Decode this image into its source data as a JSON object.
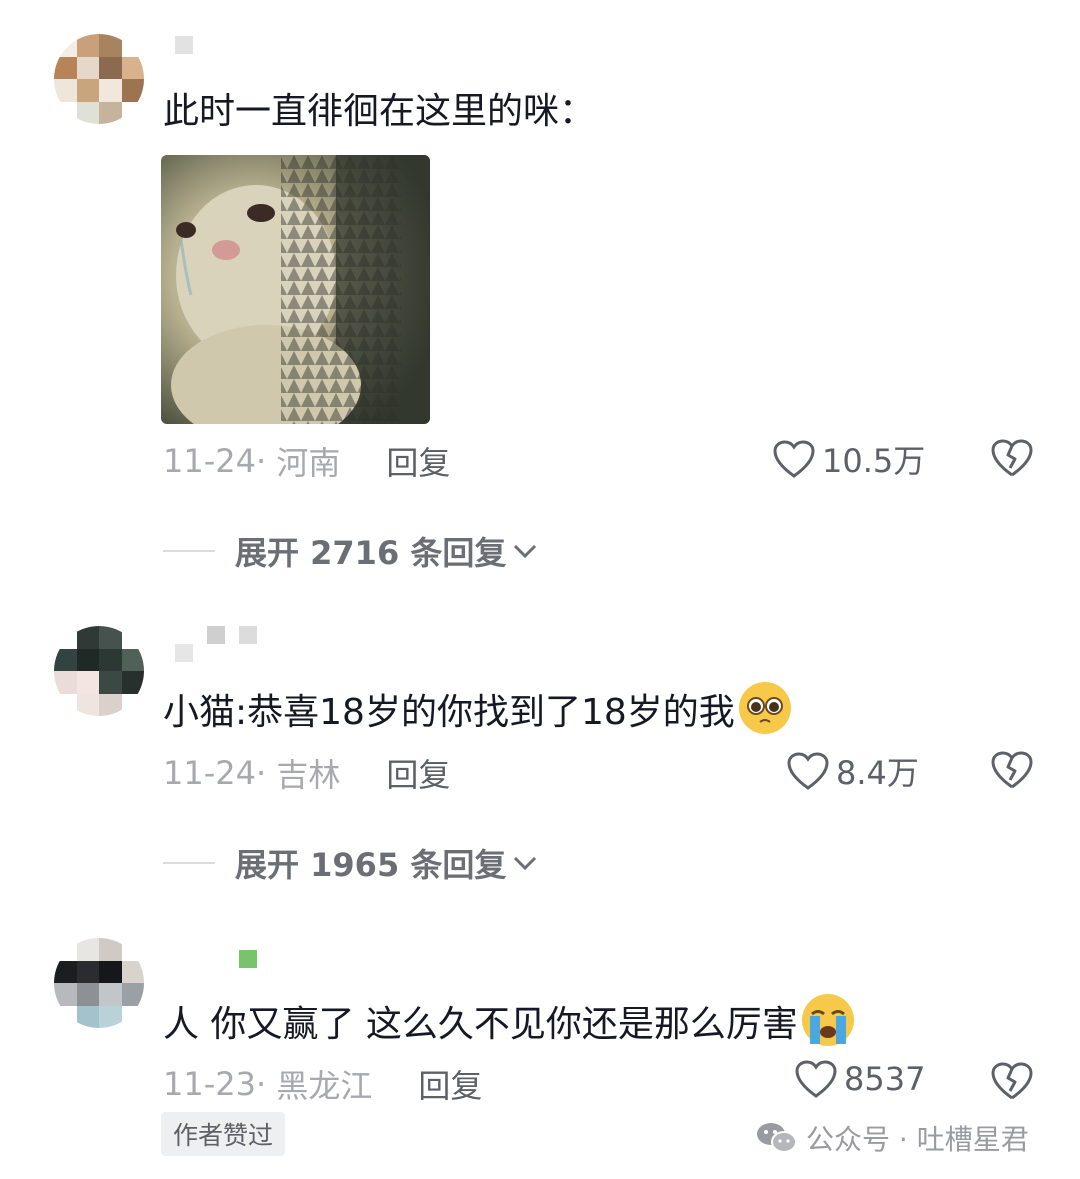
{
  "comments": [
    {
      "text": "此时一直徘徊在这里的咪：",
      "date": "11-24",
      "location": "河南",
      "reply_label": "回复",
      "likes": "10.5万",
      "expand_label": "展开 2716 条回复",
      "attachment": "crying-cat-photo"
    },
    {
      "text": "小猫:恭喜18岁的你找到了18岁的我",
      "emoji": "pleading-face-emoji",
      "date": "11-24",
      "location": "吉林",
      "reply_label": "回复",
      "likes": "8.4万",
      "expand_label": "展开 1965 条回复"
    },
    {
      "text": "人 你又赢了 这么久不见你还是那么厉害",
      "emoji": "loudly-crying-face-emoji",
      "date": "11-23",
      "location": "黑龙江",
      "reply_label": "回复",
      "likes": "8537",
      "author_badge": "作者赞过"
    }
  ],
  "watermark": {
    "text": "公众号 · 吐槽星君",
    "icon": "wechat-icon"
  },
  "colors": {
    "primary_text": "#161823",
    "meta_text": "#a7a9ae",
    "action_text": "#5e6068",
    "expand_text": "#6c6e75"
  }
}
